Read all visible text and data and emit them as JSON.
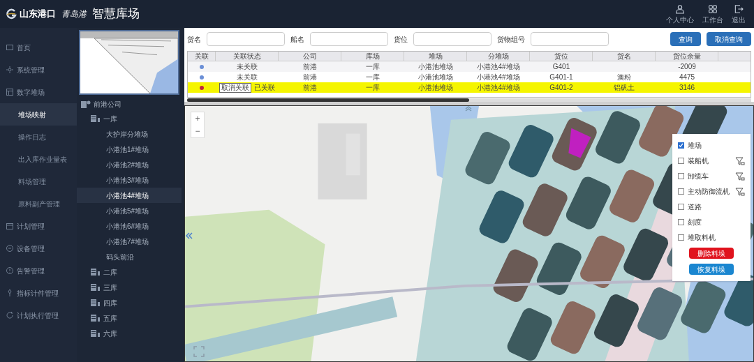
{
  "header": {
    "logos": [
      "山东港口",
      "青岛港"
    ],
    "title": "智慧库场",
    "actions": [
      {
        "label": "个人中心",
        "kind": "user"
      },
      {
        "label": "工作台",
        "kind": "grid"
      },
      {
        "label": "退出",
        "kind": "logout"
      }
    ]
  },
  "sidebar": {
    "items": [
      {
        "label": "首页",
        "selected": false,
        "kind": "home"
      },
      {
        "label": "系统管理",
        "selected": false,
        "kind": "gear"
      },
      {
        "label": "数字堆场",
        "selected": false,
        "kind": "board",
        "children": [
          {
            "label": "堆场映射",
            "selected": true
          },
          {
            "label": "操作日志",
            "selected": false
          },
          {
            "label": "出入库作业量表",
            "selected": false
          },
          {
            "label": "料场管理",
            "selected": false
          },
          {
            "label": "原料副产管理",
            "selected": false
          }
        ]
      },
      {
        "label": "计划管理",
        "selected": false,
        "kind": "calendar"
      },
      {
        "label": "设备管理",
        "selected": false,
        "kind": "device"
      },
      {
        "label": "告警管理",
        "selected": false,
        "kind": "alert"
      },
      {
        "label": "指标计件管理",
        "selected": false,
        "kind": "pin"
      },
      {
        "label": "计划执行管理",
        "selected": false,
        "kind": "cycle"
      }
    ]
  },
  "tree": {
    "label": "前港公司",
    "children": [
      {
        "label": "一库",
        "children": [
          {
            "label": "大护岸分堆场",
            "selected": false
          },
          {
            "label": "小港池1#堆场",
            "selected": false
          },
          {
            "label": "小港池2#堆场",
            "selected": false
          },
          {
            "label": "小港池3#堆场",
            "selected": false
          },
          {
            "label": "小港池4#堆场",
            "selected": true
          },
          {
            "label": "小港池5#堆场",
            "selected": false
          },
          {
            "label": "小港池6#堆场",
            "selected": false
          },
          {
            "label": "小港池7#堆场",
            "selected": false
          },
          {
            "label": "码头前沿",
            "selected": false
          }
        ]
      },
      {
        "label": "二库"
      },
      {
        "label": "三库"
      },
      {
        "label": "四库"
      },
      {
        "label": "五库"
      },
      {
        "label": "六库"
      }
    ]
  },
  "search": {
    "fields": [
      {
        "label": "货名"
      },
      {
        "label": "船名"
      },
      {
        "label": "货位"
      },
      {
        "label": "货物组号"
      }
    ],
    "buttons": [
      "查询",
      "取消查询"
    ]
  },
  "table": {
    "columns": [
      "关联",
      "关联状态",
      "公司",
      "库场",
      "堆场",
      "分堆场",
      "货位",
      "货名",
      "货位余量"
    ],
    "rows": [
      {
        "color": "#6b8fd6",
        "selected": false,
        "cells": [
          "",
          "未关联",
          "前港",
          "一库",
          "小港池堆场",
          "小港池4#堆场",
          "G401",
          "",
          "-2009"
        ]
      },
      {
        "color": "#6b8fd6",
        "selected": false,
        "cells": [
          "",
          "未关联",
          "前港",
          "一库",
          "小港池堆场",
          "小港池4#堆场",
          "G401-1",
          "澳粉",
          "4475"
        ]
      },
      {
        "color": "#c0283a",
        "selected": true,
        "action": "取消关联",
        "cells": [
          "",
          "已关联",
          "前港",
          "一库",
          "小港池堆场",
          "小港池4#堆场",
          "G401-2",
          "铝矾土",
          "3146"
        ]
      }
    ]
  },
  "map": {
    "zoom": [
      "+",
      "−"
    ],
    "layers": [
      {
        "label": "堆场",
        "checked": true,
        "filter": false
      },
      {
        "label": "装船机",
        "checked": false,
        "filter": true
      },
      {
        "label": "卸缆车",
        "checked": false,
        "filter": true
      },
      {
        "label": "主动防御流机",
        "checked": false,
        "filter": true
      },
      {
        "label": "道路",
        "checked": false,
        "filter": false
      },
      {
        "label": "刻度",
        "checked": false,
        "filter": false
      },
      {
        "label": "堆取料机",
        "checked": false,
        "filter": false
      }
    ],
    "buttons": [
      {
        "label": "删除料垛",
        "kind": "danger"
      },
      {
        "label": "恢复料垛",
        "kind": "primary"
      }
    ]
  }
}
